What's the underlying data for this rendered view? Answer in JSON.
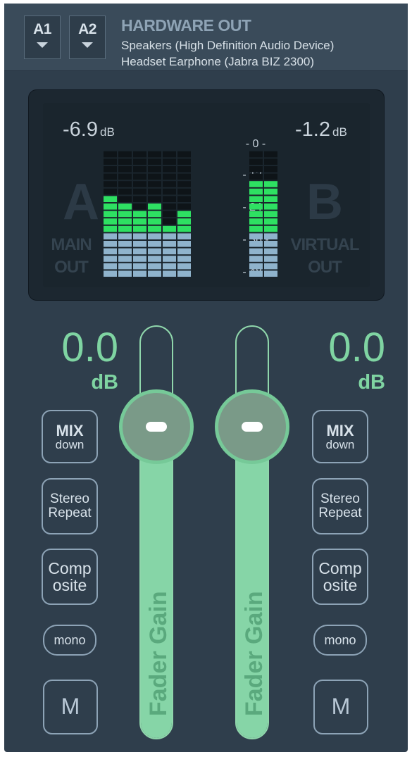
{
  "header": {
    "a1_label": "A1",
    "a2_label": "A2",
    "title": "HARDWARE OUT",
    "device_1": "Speakers (High Definition Audio Device)",
    "device_2": "Headset Earphone (Jabra BIZ 2300)"
  },
  "meter": {
    "left_level": "-6.9",
    "right_level": "-1.2",
    "level_unit": "dB",
    "bus_a": "A",
    "bus_a_sub1": "MAIN",
    "bus_a_sub2": "OUT",
    "bus_b": "B",
    "bus_b_sub1": "VIRTUAL",
    "bus_b_sub2": "OUT",
    "scale": [
      "- 0 -",
      "- 12 -",
      "- 24 -",
      "- 36 -",
      "- 48 -"
    ],
    "left_bars": [
      11,
      10,
      9,
      10,
      7,
      9
    ],
    "right_bars": [
      13,
      13
    ],
    "segments_total": 17,
    "green_threshold": 6,
    "colors": {
      "green": "#2ee062",
      "blue": "#8fb3cc",
      "off": "#0e1418"
    }
  },
  "strips": [
    {
      "gain_value": "0.0",
      "gain_unit": "dB",
      "mix_l1": "MIX",
      "mix_l2": "down",
      "stereo_l1": "Stereo",
      "stereo_l2": "Repeat",
      "comp_l1": "Comp",
      "comp_l2": "osite",
      "mono_label": "mono",
      "mute_label": "M",
      "fader_label": "Fader Gain",
      "fader_fill": 0.83
    },
    {
      "gain_value": "0.0",
      "gain_unit": "dB",
      "mix_l1": "MIX",
      "mix_l2": "down",
      "stereo_l1": "Stereo",
      "stereo_l2": "Repeat",
      "comp_l1": "Comp",
      "comp_l2": "osite",
      "mono_label": "mono",
      "mute_label": "M",
      "fader_label": "Fader Gain",
      "fader_fill": 0.83
    }
  ]
}
